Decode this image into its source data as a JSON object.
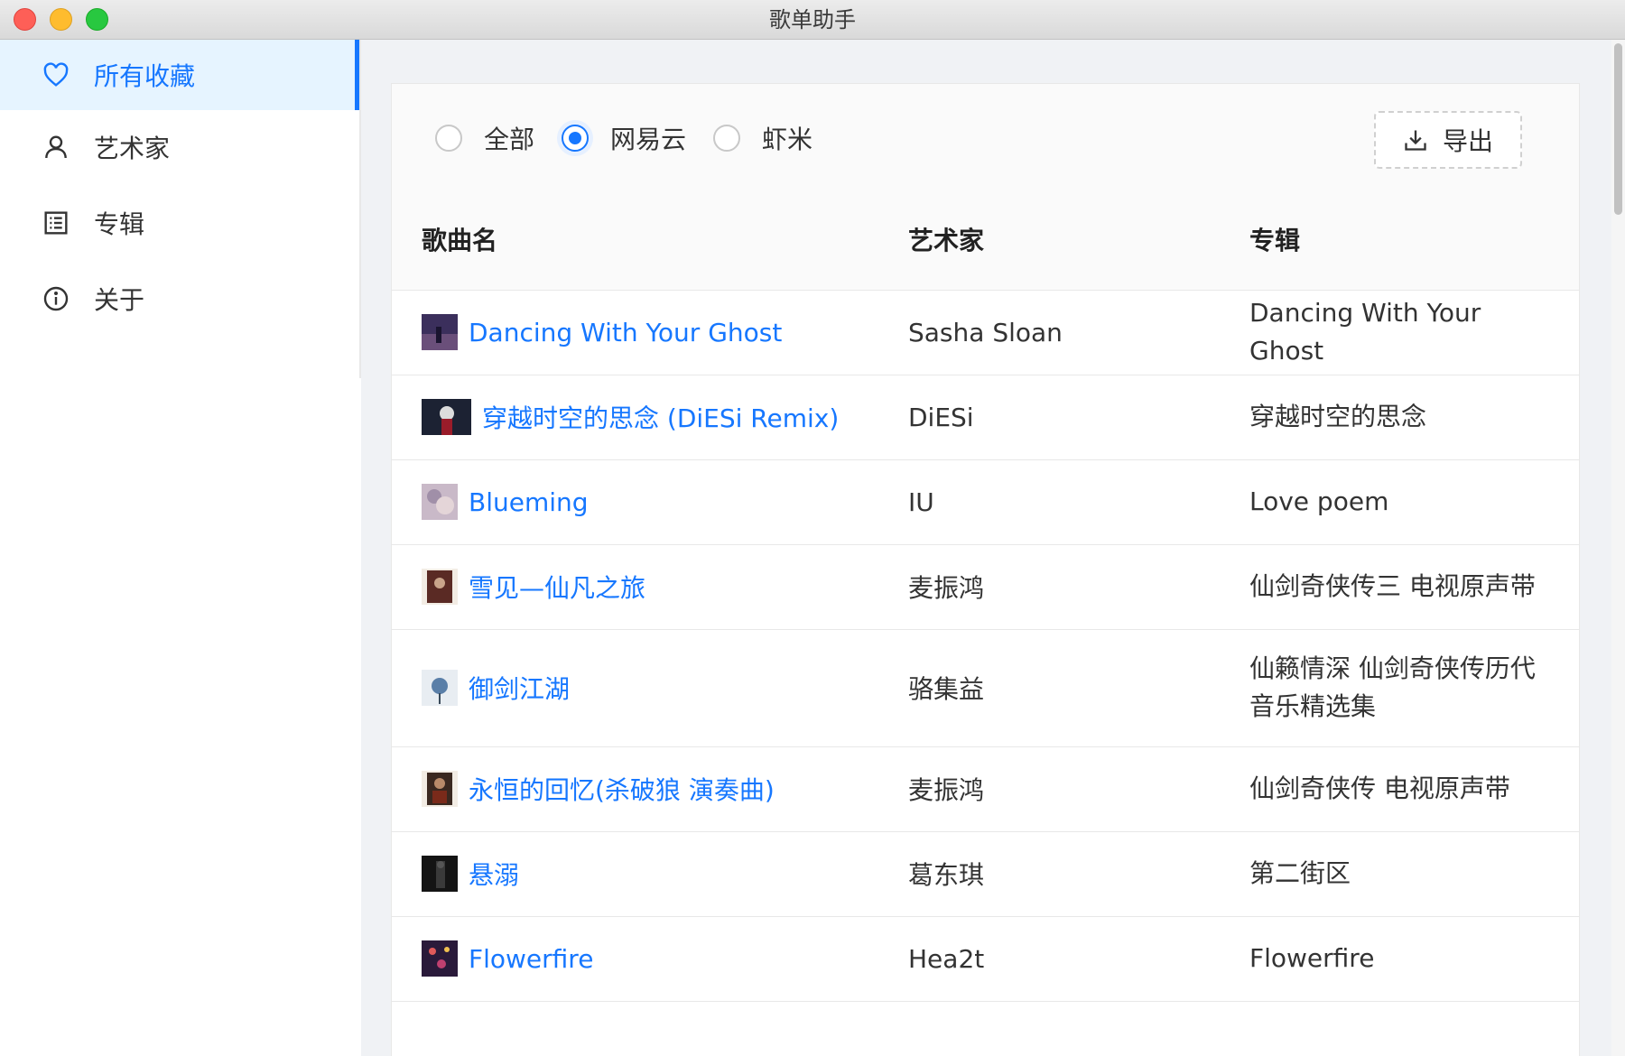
{
  "window": {
    "title": "歌单助手"
  },
  "sidebar": {
    "items": [
      {
        "label": "所有收藏",
        "icon": "heart-icon",
        "active": true
      },
      {
        "label": "艺术家",
        "icon": "user-icon"
      },
      {
        "label": "专辑",
        "icon": "list-icon"
      },
      {
        "label": "关于",
        "icon": "info-icon"
      }
    ]
  },
  "filter": {
    "options": [
      {
        "label": "全部",
        "checked": false
      },
      {
        "label": "网易云",
        "checked": true
      },
      {
        "label": "虾米",
        "checked": false
      }
    ],
    "export_label": "导出"
  },
  "table": {
    "headers": [
      "歌曲名",
      "艺术家",
      "专辑"
    ],
    "rows": [
      {
        "song": "Dancing With Your Ghost",
        "artist": "Sasha Sloan",
        "album": "Dancing With Your Ghost"
      },
      {
        "song": "穿越时空的思念 (DiESi Remix)",
        "artist": "DiESi",
        "album": "穿越时空的思念"
      },
      {
        "song": "Blueming",
        "artist": "IU",
        "album": "Love poem"
      },
      {
        "song": "雪见—仙凡之旅",
        "artist": "麦振鸿",
        "album": "仙剑奇侠传三 电视原声带"
      },
      {
        "song": "御剑江湖",
        "artist": "骆集益",
        "album": "仙籁情深 仙剑奇侠传历代音乐精选集"
      },
      {
        "song": "永恒的回忆(杀破狼 演奏曲)",
        "artist": "麦振鸿",
        "album": "仙剑奇侠传 电视原声带"
      },
      {
        "song": "悬溺",
        "artist": "葛东琪",
        "album": "第二街区"
      },
      {
        "song": "Flowerfire",
        "artist": "Hea2t",
        "album": "Flowerfire"
      }
    ]
  },
  "colors": {
    "accent": "#1677ff",
    "active_bg": "#e6f4ff",
    "content_bg": "#f0f2f5"
  }
}
